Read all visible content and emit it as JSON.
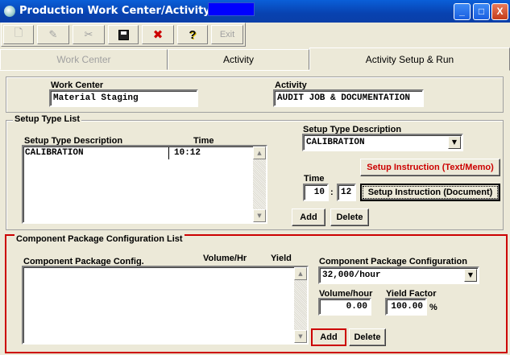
{
  "window": {
    "title": "Production Work Center/Activity Setup",
    "controls": [
      "_",
      "□",
      "X"
    ]
  },
  "toolbar": {
    "buttons": [
      {
        "name": "new-icon",
        "glyph": "🗋"
      },
      {
        "name": "edit-icon",
        "glyph": "✎"
      },
      {
        "name": "cut-icon",
        "glyph": "✂"
      },
      {
        "name": "save-icon",
        "glyph": "💾"
      },
      {
        "name": "delete-icon",
        "glyph": "✖"
      },
      {
        "name": "help-icon",
        "glyph": "?"
      }
    ],
    "exit_label": "Exit"
  },
  "tabs": [
    {
      "label": "Work Center",
      "state": "disabled"
    },
    {
      "label": "Activity",
      "state": "normal"
    },
    {
      "label": "Activity Setup & Run",
      "state": "active"
    }
  ],
  "header": {
    "work_center_label": "Work Center",
    "work_center_value": "Material Staging",
    "activity_label": "Activity",
    "activity_value": "AUDIT JOB & DOCUMENTATION"
  },
  "setup": {
    "group_title": "Setup Type List",
    "col_description": "Setup Type Description",
    "col_time": "Time",
    "rows": [
      {
        "description": "CALIBRATION",
        "time": "10:12"
      }
    ],
    "desc_label": "Setup Type Description",
    "desc_value": "CALIBRATION",
    "time_label": "Time",
    "time_hours": "10",
    "time_sep": ":",
    "time_minutes": "12",
    "instr_text_button": "Setup Instruction (Text/Memo)",
    "instr_doc_button": "Setup Instruction (Document)",
    "add_button": "Add",
    "delete_button": "Delete"
  },
  "component": {
    "group_title": "Component Package Configuration List",
    "col_config": "Component Package Config.",
    "col_volume": "Volume/Hr",
    "col_yield": "Yield",
    "config_label": "Component Package Configuration",
    "config_value": "32,000/hour",
    "volume_label": "Volume/hour",
    "volume_value": "0.00",
    "yield_label": "Yield Factor",
    "yield_value": "100.00",
    "yield_unit": "%",
    "add_button": "Add",
    "delete_button": "Delete"
  },
  "colors": {
    "titlebar": "#0842b0",
    "highlight_red": "#cc0000",
    "window_bg": "#ece9d8"
  }
}
